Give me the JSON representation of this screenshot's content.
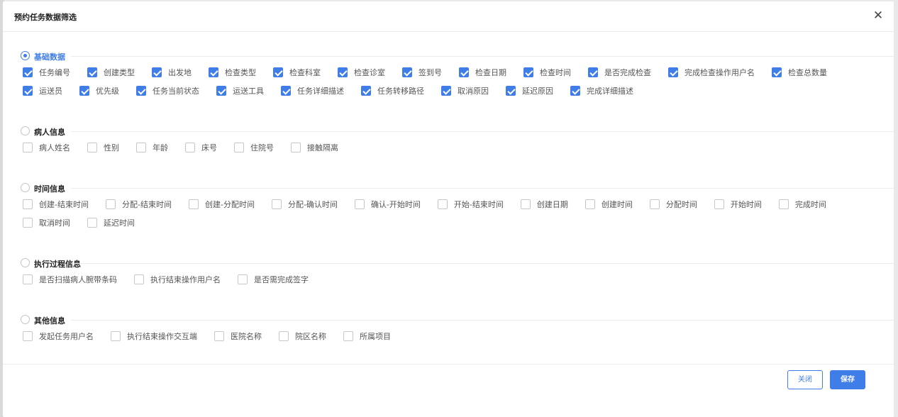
{
  "dialog": {
    "title": "预约任务数据筛选",
    "close_glyph": "✕",
    "buttons": {
      "close_label": "关闭",
      "save_label": "保存"
    }
  },
  "colors": {
    "accent": "#3f7de8"
  },
  "sections": [
    {
      "title": "基础数据",
      "selected": true,
      "rows": [
        [
          {
            "label": "任务编号",
            "checked": true
          },
          {
            "label": "创建类型",
            "checked": true
          },
          {
            "label": "出发地",
            "checked": true
          },
          {
            "label": "检查类型",
            "checked": true
          },
          {
            "label": "检查科室",
            "checked": true
          },
          {
            "label": "检查诊室",
            "checked": true
          },
          {
            "label": "签到号",
            "checked": true
          },
          {
            "label": "检查日期",
            "checked": true
          },
          {
            "label": "检查时间",
            "checked": true
          },
          {
            "label": "是否完成检查",
            "checked": true
          },
          {
            "label": "完成检查操作用户名",
            "checked": true
          },
          {
            "label": "检查总数量",
            "checked": true
          }
        ],
        [
          {
            "label": "运送员",
            "checked": true
          },
          {
            "label": "优先级",
            "checked": true
          },
          {
            "label": "任务当前状态",
            "checked": true
          },
          {
            "label": "运送工具",
            "checked": true
          },
          {
            "label": "任务详细描述",
            "checked": true
          },
          {
            "label": "任务转移路径",
            "checked": true
          },
          {
            "label": "取消原因",
            "checked": true
          },
          {
            "label": "延迟原因",
            "checked": true
          },
          {
            "label": "完成详细描述",
            "checked": true
          }
        ]
      ]
    },
    {
      "title": "病人信息",
      "selected": false,
      "rows": [
        [
          {
            "label": "病人姓名",
            "checked": false
          },
          {
            "label": "性别",
            "checked": false
          },
          {
            "label": "年龄",
            "checked": false
          },
          {
            "label": "床号",
            "checked": false
          },
          {
            "label": "住院号",
            "checked": false
          },
          {
            "label": "接触隔离",
            "checked": false
          }
        ]
      ]
    },
    {
      "title": "时间信息",
      "selected": false,
      "rows": [
        [
          {
            "label": "创建-结束时间",
            "checked": false
          },
          {
            "label": "分配-结束时间",
            "checked": false
          },
          {
            "label": "创建-分配时间",
            "checked": false
          },
          {
            "label": "分配-确认时间",
            "checked": false
          },
          {
            "label": "确认-开始时间",
            "checked": false
          },
          {
            "label": "开始-结束时间",
            "checked": false
          },
          {
            "label": "创建日期",
            "checked": false
          },
          {
            "label": "创建时间",
            "checked": false
          },
          {
            "label": "分配时间",
            "checked": false
          },
          {
            "label": "开始时间",
            "checked": false
          },
          {
            "label": "完成时间",
            "checked": false
          }
        ],
        [
          {
            "label": "取消时间",
            "checked": false
          },
          {
            "label": "延迟时间",
            "checked": false
          }
        ]
      ]
    },
    {
      "title": "执行过程信息",
      "selected": false,
      "rows": [
        [
          {
            "label": "是否扫描病人腕带条码",
            "checked": false
          },
          {
            "label": "执行结束操作用户名",
            "checked": false
          },
          {
            "label": "是否需完成签字",
            "checked": false
          }
        ]
      ]
    },
    {
      "title": "其他信息",
      "selected": false,
      "rows": [
        [
          {
            "label": "发起任务用户名",
            "checked": false
          },
          {
            "label": "执行结束操作交互端",
            "checked": false
          },
          {
            "label": "医院名称",
            "checked": false
          },
          {
            "label": "院区名称",
            "checked": false
          },
          {
            "label": "所属项目",
            "checked": false
          }
        ]
      ]
    }
  ]
}
